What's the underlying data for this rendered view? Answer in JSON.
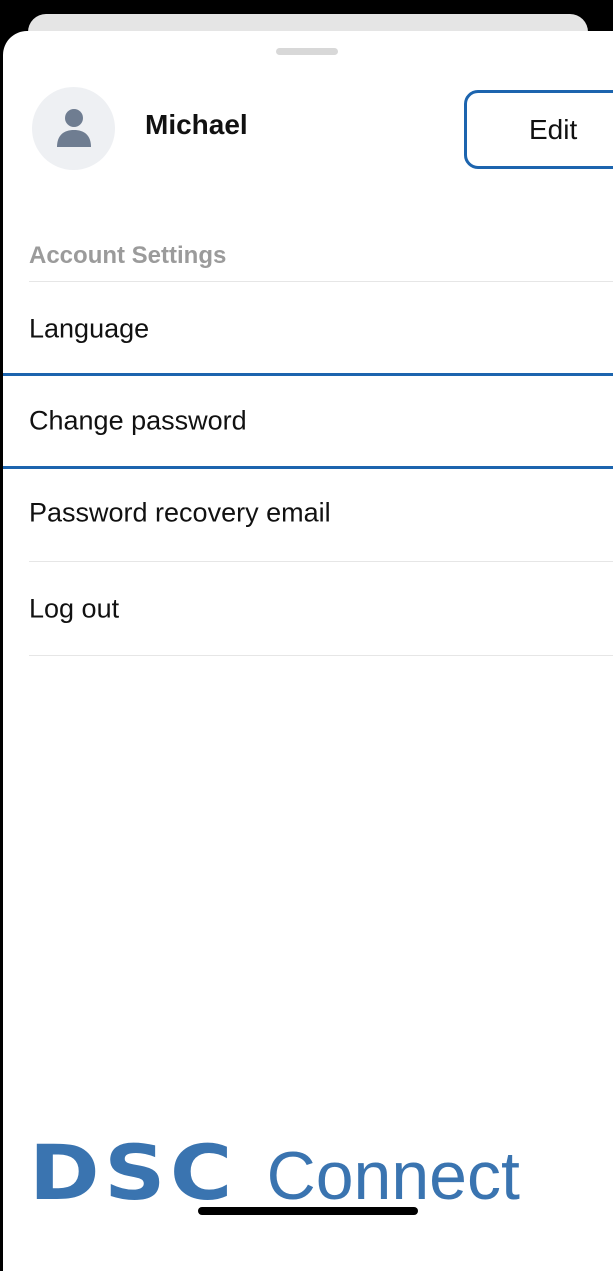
{
  "profile": {
    "name": "Michael",
    "edit_label": "Edit"
  },
  "account_settings": {
    "header": "Account Settings",
    "items": [
      {
        "label": "Language"
      },
      {
        "label": "Change password",
        "selected": true
      },
      {
        "label": "Password recovery email"
      },
      {
        "label": "Log out"
      }
    ]
  },
  "branding": {
    "mark": "DSC",
    "word": "Connect"
  },
  "colors": {
    "accent": "#1c64ae",
    "brand": "#3a74b0",
    "section_header": "#9b9b9b",
    "avatar_bg": "#eef0f3",
    "avatar_icon": "#6f7d91"
  },
  "icons": {
    "avatar": "person-icon"
  }
}
